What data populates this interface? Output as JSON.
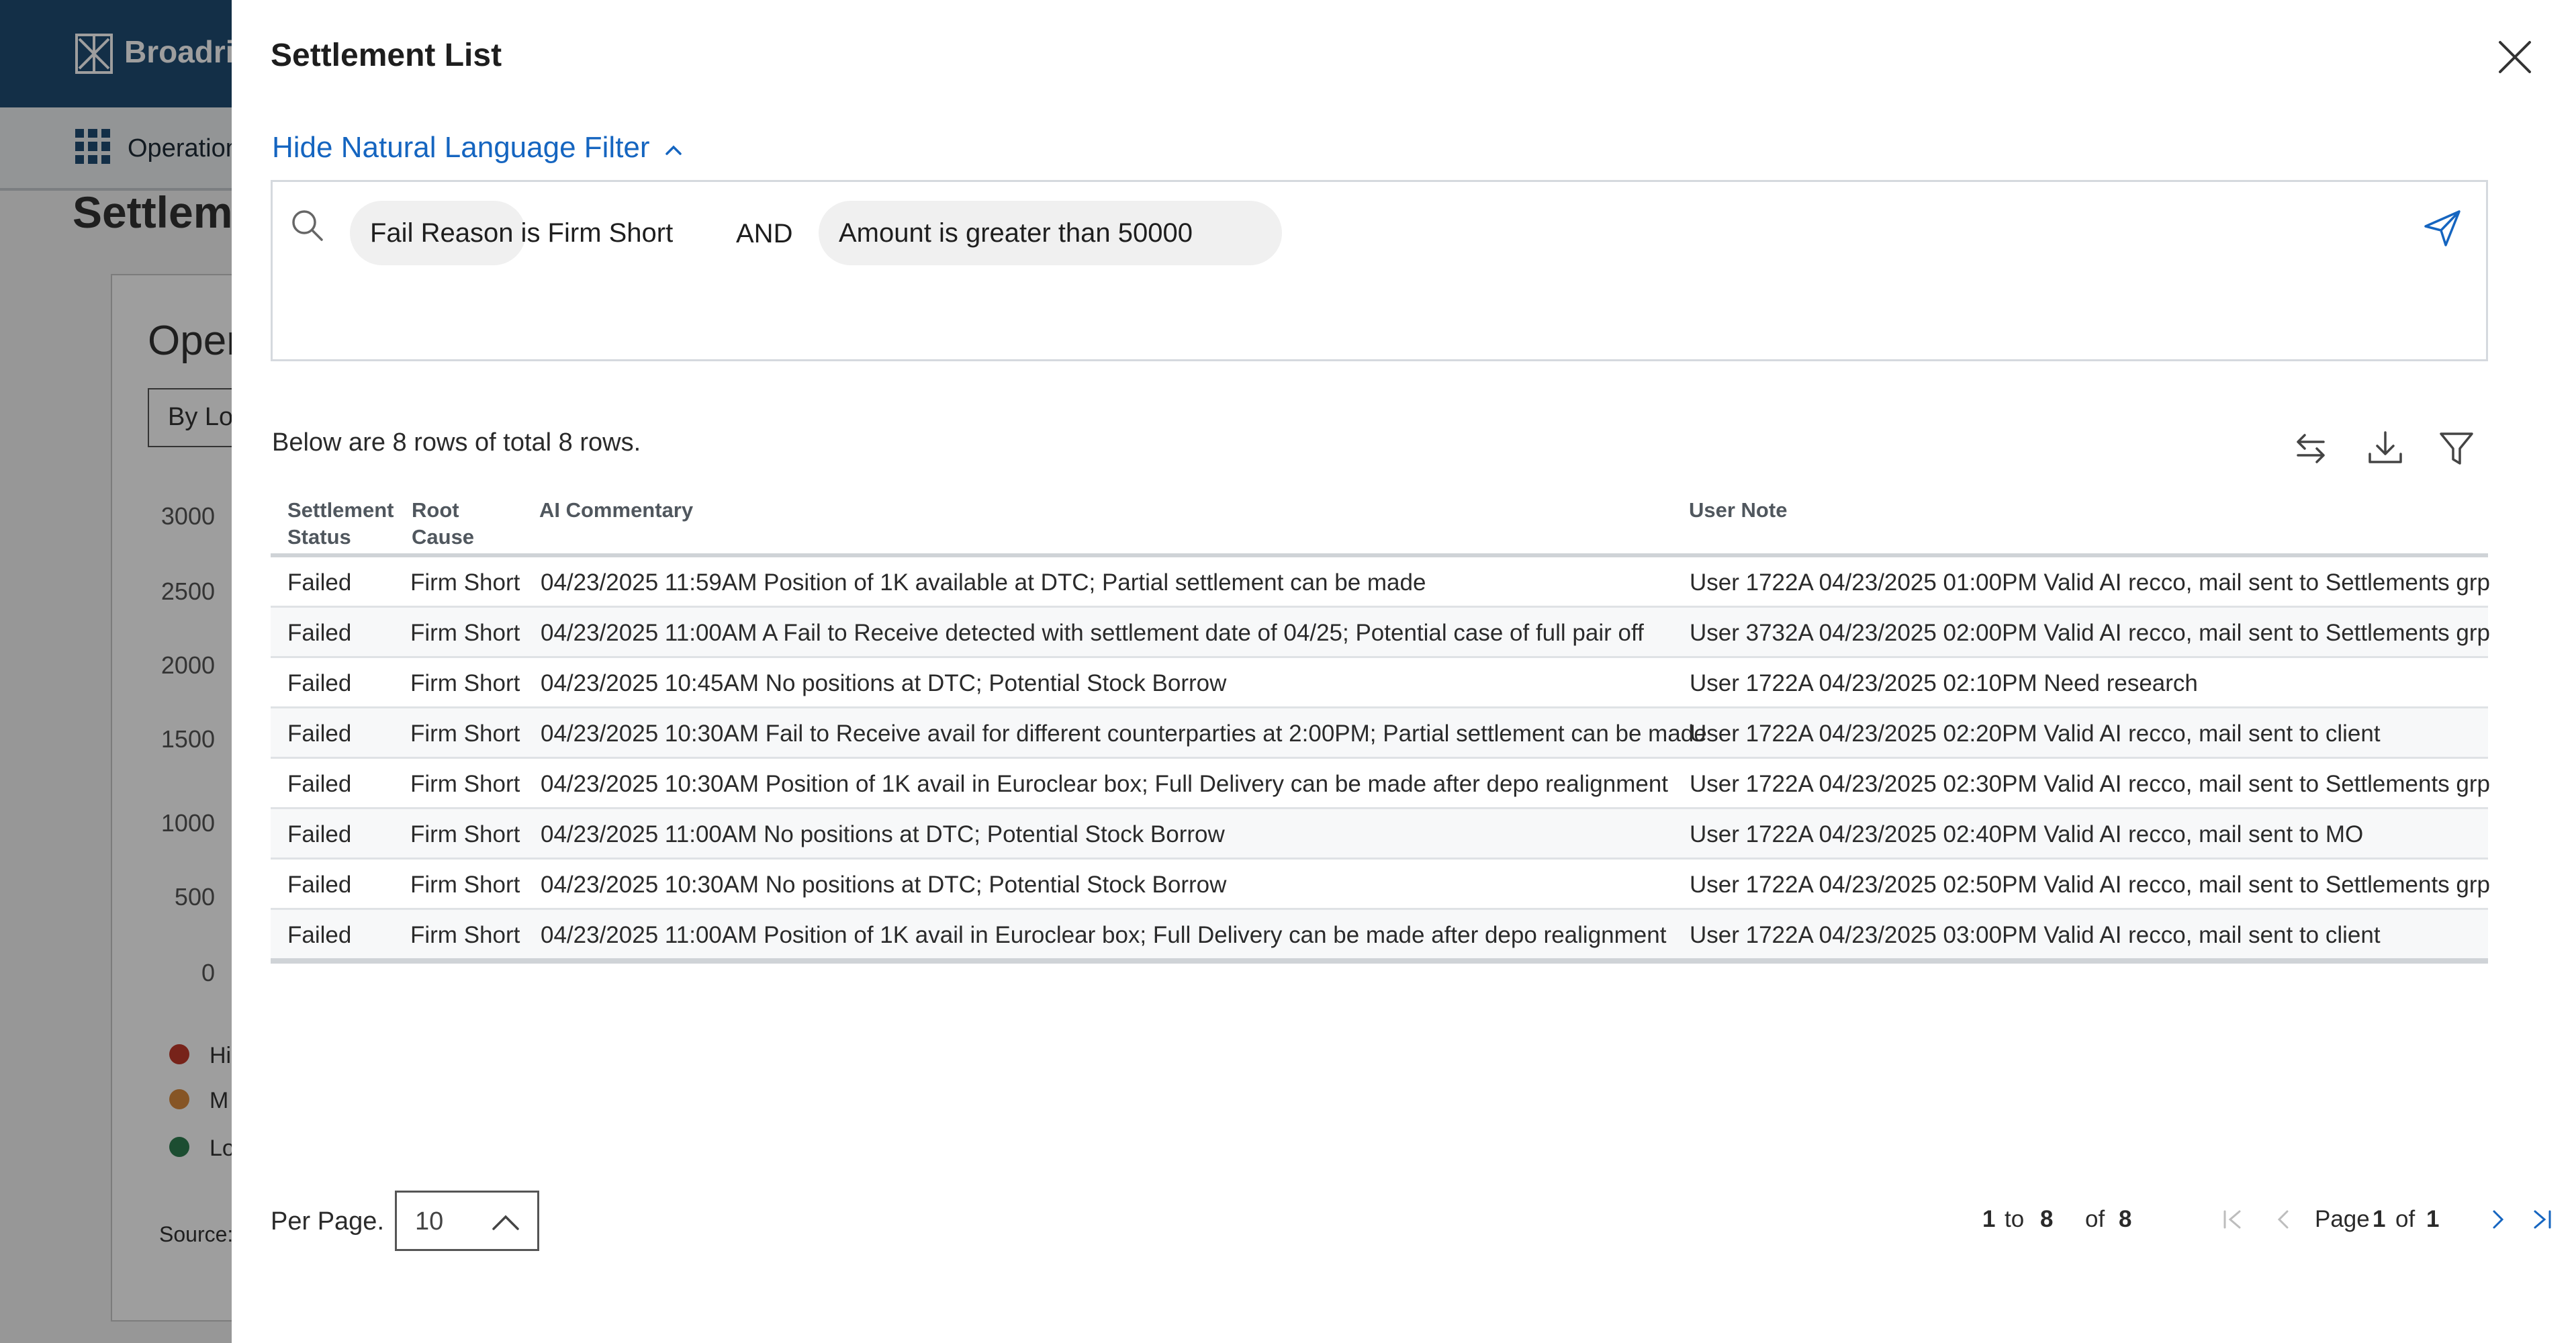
{
  "background": {
    "brand": "Broadric",
    "nav_label": "Operation",
    "page_title": "Settleme",
    "card_title": "Oper",
    "select_text": "By Lo",
    "y_ticks": [
      "3000",
      "2500",
      "2000",
      "1500",
      "1000",
      "500",
      "0"
    ],
    "legend": [
      {
        "label": "Hi",
        "color": "#c0392b"
      },
      {
        "label": "M",
        "color": "#d98a3d"
      },
      {
        "label": "Lo",
        "color": "#2e7d4f"
      }
    ],
    "source_label": "Source:"
  },
  "panel": {
    "title": "Settlement List",
    "close_icon": "close-icon",
    "nl_toggle_label": "Hide Natural Language Filter",
    "filter": {
      "chips": [
        "Fail Reason is Firm Short",
        "Amount is greater than 50000"
      ],
      "operator": "AND"
    },
    "rows_summary": "Below are 8 rows of total 8 rows.",
    "toolbar_icons": [
      "swap-columns-icon",
      "download-icon",
      "filter-icon"
    ],
    "table": {
      "headers": {
        "status": "Settlement Status",
        "root_cause": "Root Cause",
        "ai_commentary": "AI Commentary",
        "user_note": "User Note"
      },
      "rows": [
        {
          "status": "Failed",
          "root_cause": "Firm Short",
          "ai": "04/23/2025 11:59AM Position of 1K available at DTC; Partial settlement can be made",
          "note": "User 1722A 04/23/2025 01:00PM Valid AI recco, mail sent to Settlements grp"
        },
        {
          "status": "Failed",
          "root_cause": "Firm Short",
          "ai": "04/23/2025 11:00AM A Fail to Receive detected with settlement date of 04/25; Potential case of full pair off",
          "note": "User 3732A 04/23/2025 02:00PM Valid AI recco, mail sent to Settlements grp"
        },
        {
          "status": "Failed",
          "root_cause": "Firm Short",
          "ai": "04/23/2025 10:45AM No positions at DTC; Potential Stock Borrow",
          "note": "User 1722A 04/23/2025 02:10PM Need research"
        },
        {
          "status": "Failed",
          "root_cause": "Firm Short",
          "ai": "04/23/2025 10:30AM Fail to Receive avail for different counterparties at 2:00PM; Partial settlement can be made",
          "note": "User 1722A 04/23/2025 02:20PM Valid AI recco, mail sent to client"
        },
        {
          "status": "Failed",
          "root_cause": "Firm Short",
          "ai": "04/23/2025 10:30AM Position of 1K avail in Euroclear box; Full Delivery can be made after depo realignment",
          "note": "User 1722A 04/23/2025 02:30PM Valid AI recco, mail sent to Settlements grp"
        },
        {
          "status": "Failed",
          "root_cause": "Firm Short",
          "ai": "04/23/2025 11:00AM No positions at DTC; Potential Stock Borrow",
          "note": "User 1722A 04/23/2025 02:40PM Valid AI recco, mail sent to MO"
        },
        {
          "status": "Failed",
          "root_cause": "Firm Short",
          "ai": "04/23/2025 10:30AM No positions at DTC; Potential Stock Borrow",
          "note": "User 1722A 04/23/2025 02:50PM Valid AI recco, mail sent to Settlements grp"
        },
        {
          "status": "Failed",
          "root_cause": "Firm Short",
          "ai": "04/23/2025 11:00AM Position of 1K avail in Euroclear box; Full Delivery can be made after depo realignment",
          "note": "User 1722A 04/23/2025 03:00PM Valid AI recco, mail sent to client"
        }
      ]
    },
    "pagination": {
      "per_page_label": "Per Page.",
      "per_page_value": "10",
      "range_start": "1",
      "range_to": "to",
      "range_end": "8",
      "of_label": "of",
      "total": "8",
      "page_label": "Page",
      "page_current": "1",
      "page_of": "of",
      "page_total": "1"
    },
    "colors": {
      "accent": "#1565c0",
      "topbar": "#1f4c73",
      "chip_bg": "#f0f0f0"
    }
  }
}
